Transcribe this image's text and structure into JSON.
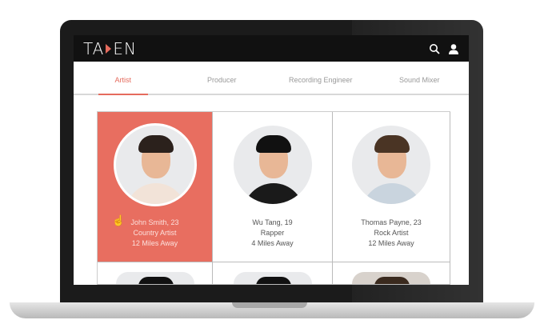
{
  "app": {
    "logo": "TALENT"
  },
  "tabs": [
    {
      "label": "Artist"
    },
    {
      "label": "Producer"
    },
    {
      "label": "Recording Engineer"
    },
    {
      "label": "Sound Mixer"
    }
  ],
  "cards": [
    {
      "name": "John Smith, 23",
      "role": "Country Artist",
      "distance": "12 Miles Away",
      "hair": "#2b211c",
      "shirt": "#f2e3d8"
    },
    {
      "name": "Wu Tang, 19",
      "role": "Rapper",
      "distance": "4 Miles Away",
      "hair": "#111",
      "shirt": "#1a1a1a"
    },
    {
      "name": "Thomas Payne, 23",
      "role": "Rock Artist",
      "distance": "12 Miles Away",
      "hair": "#4a3424",
      "shirt": "#c9d4de"
    }
  ],
  "colors": {
    "accent": "#e86e60"
  }
}
